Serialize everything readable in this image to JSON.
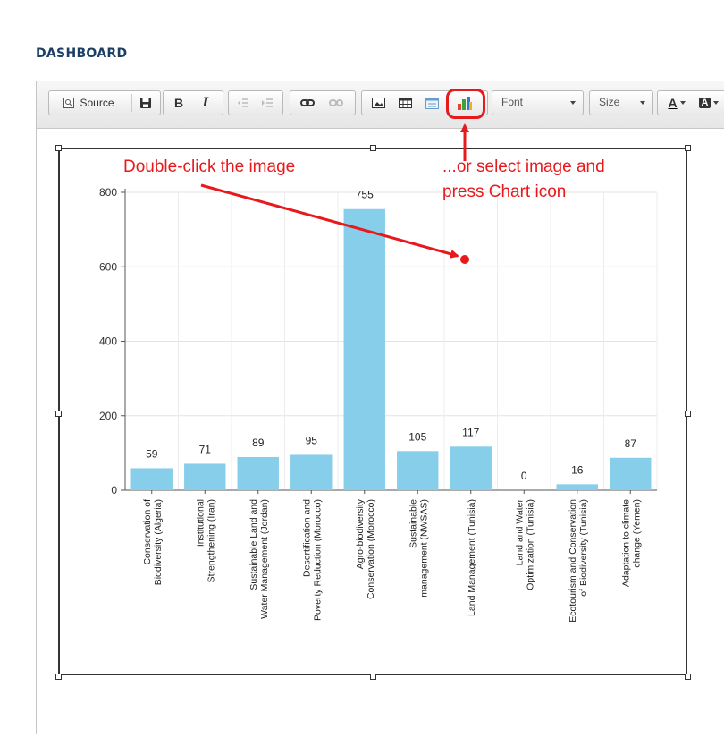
{
  "page": {
    "title": "DASHBOARD"
  },
  "toolbar": {
    "source_label": "Source",
    "bold_label": "B",
    "italic_label": "I",
    "font_label": "Font",
    "size_label": "Size",
    "text_color_label": "A",
    "bg_color_label": "A"
  },
  "annotations": {
    "double_click": "Double-click the image",
    "select_line1": "...or select image and",
    "select_line2": "press Chart icon",
    "color": "#e8191c"
  },
  "chart_data": {
    "type": "bar",
    "title": "",
    "xlabel": "",
    "ylabel": "",
    "ylim": [
      0,
      800
    ],
    "yticks": [
      0,
      200,
      400,
      600,
      800
    ],
    "grid": true,
    "bar_color": "#87ceeb",
    "categories": [
      [
        "Conservation of",
        "Biodiversity (Algeria)"
      ],
      [
        "Institutional",
        "Strengthening (Iran)"
      ],
      [
        "Sustainable Land and",
        "Water Management (Jordan)"
      ],
      [
        "Desertification and",
        "Poverty Reduction (Morocco)"
      ],
      [
        "Agro-biodiversity",
        "Conservation (Morocco)"
      ],
      [
        "Sustainable",
        "management (NWSAS)"
      ],
      [
        "Land Management (Tunisia)"
      ],
      [
        "Land and Water",
        "Optimization (Tunisia)"
      ],
      [
        "Ecotourism and Conservation",
        "of Biodiversity (Tunisia)"
      ],
      [
        "Adaptation to climate",
        "change (Yemen)"
      ]
    ],
    "values": [
      59,
      71,
      89,
      95,
      755,
      105,
      117,
      0,
      16,
      87
    ]
  }
}
